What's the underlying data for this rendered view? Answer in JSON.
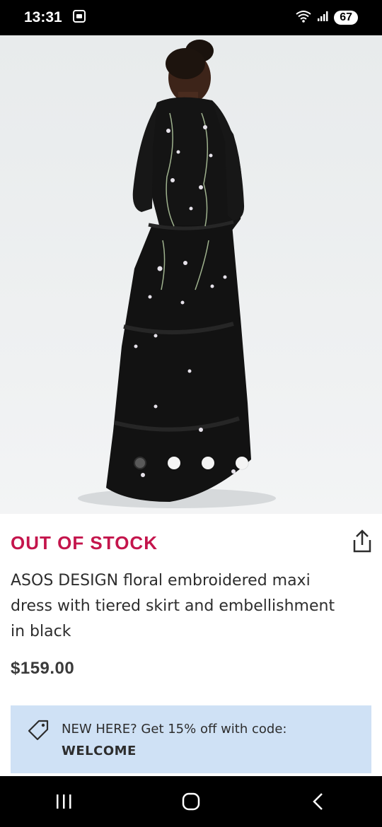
{
  "status_bar": {
    "time": "13:31",
    "battery": "67",
    "icons": [
      "screenshot-icon",
      "wifi-icon",
      "signal-icon",
      "battery-icon"
    ]
  },
  "product": {
    "image_count": 4,
    "active_image_index": 0,
    "stock_status": "OUT OF STOCK",
    "name": "ASOS DESIGN floral embroidered maxi dress with tiered skirt and embellishment in black",
    "price": "$159.00"
  },
  "promo": {
    "text": "NEW HERE? Get 15% off with code:",
    "code": "WELCOME",
    "icon": "tag-icon"
  },
  "nav_bar": {
    "buttons": [
      "recent-apps",
      "home",
      "back"
    ]
  },
  "colors": {
    "stock_status": "#c4154c",
    "promo_background": "#cfe1f5",
    "text": "#2d2d2d"
  }
}
